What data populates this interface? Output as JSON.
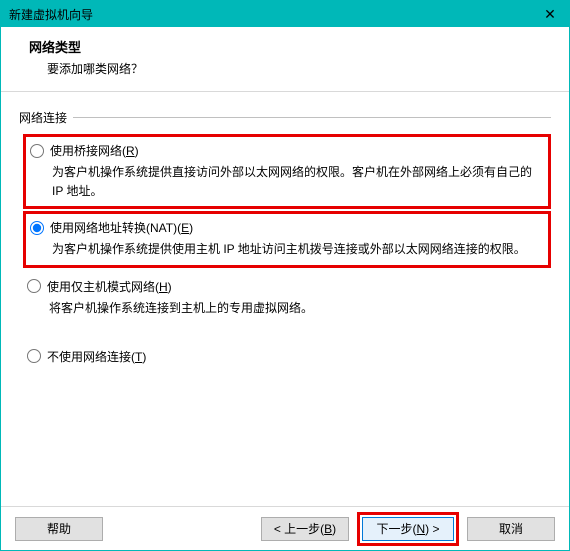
{
  "window": {
    "title": "新建虚拟机向导"
  },
  "header": {
    "heading": "网络类型",
    "subheading": "要添加哪类网络？"
  },
  "fieldset": {
    "legend": "网络连接"
  },
  "options": {
    "bridged": {
      "label_pre": "使用桥接网络(",
      "hotkey": "R",
      "label_post": ")",
      "desc": "为客户机操作系统提供直接访问外部以太网网络的权限。客户机在外部网络上必须有自己的 IP 地址。",
      "checked": false
    },
    "nat": {
      "label_pre": "使用网络地址转换(NAT)(",
      "hotkey": "E",
      "label_post": ")",
      "desc": "为客户机操作系统提供使用主机 IP 地址访问主机拨号连接或外部以太网网络连接的权限。",
      "checked": true
    },
    "hostonly": {
      "label_pre": "使用仅主机模式网络(",
      "hotkey": "H",
      "label_post": ")",
      "desc": "将客户机操作系统连接到主机上的专用虚拟网络。",
      "checked": false
    },
    "none": {
      "label_pre": "不使用网络连接(",
      "hotkey": "T",
      "label_post": ")",
      "checked": false
    }
  },
  "buttons": {
    "help": "帮助",
    "back_pre": "< 上一步(",
    "back_hot": "B",
    "back_post": ")",
    "next_pre": "下一步(",
    "next_hot": "N",
    "next_post": ") >",
    "cancel": "取消"
  }
}
